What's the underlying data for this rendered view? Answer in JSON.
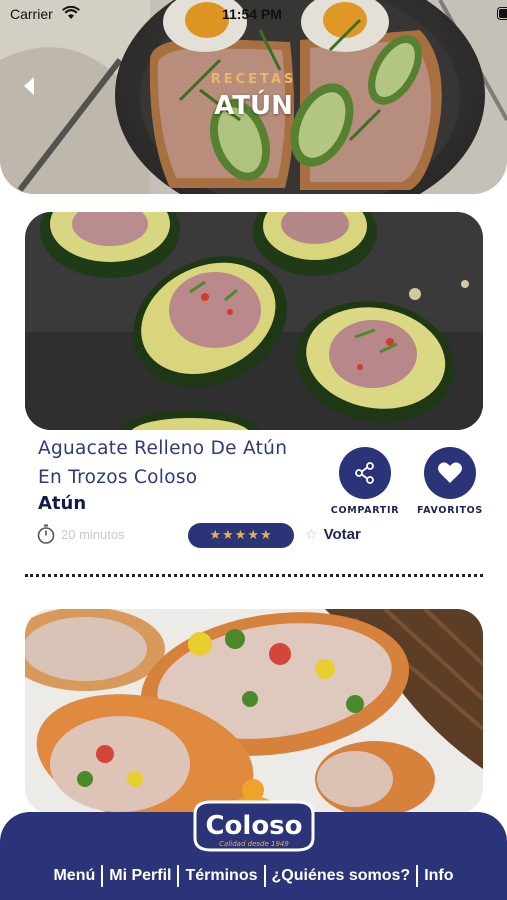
{
  "status_bar": {
    "carrier": "Carrier",
    "time": "11:54 PM"
  },
  "header": {
    "subtitle": "RECETAS",
    "title": "ATÚN"
  },
  "recipes": [
    {
      "title_line1": "Aguacate Relleno De Atún",
      "title_line2": "En Trozos Coloso",
      "category": "Atún",
      "time": "20 minutos",
      "rating_stars": "★★★★★",
      "rating": 5,
      "vote_label": "Votar",
      "share_label": "COMPARTIR",
      "favorites_label": "FAVORITOS"
    },
    {
      "image": "tuna-wrap-photo"
    }
  ],
  "footer": {
    "logo_text": "Coloso",
    "logo_tagline": "Calidad desde 1949",
    "nav": [
      "Menú",
      "Mi Perfil",
      "Términos",
      "¿Quiénes somos?",
      "Info"
    ]
  },
  "colors": {
    "primary": "#2c3479",
    "title_blue": "#2b3a80",
    "gold": "#e7b86a",
    "star": "#e8b24a"
  },
  "icons": [
    "wifi-icon",
    "battery-icon",
    "back-chevron-icon",
    "share-icon",
    "heart-icon",
    "timer-icon",
    "star-icon"
  ]
}
